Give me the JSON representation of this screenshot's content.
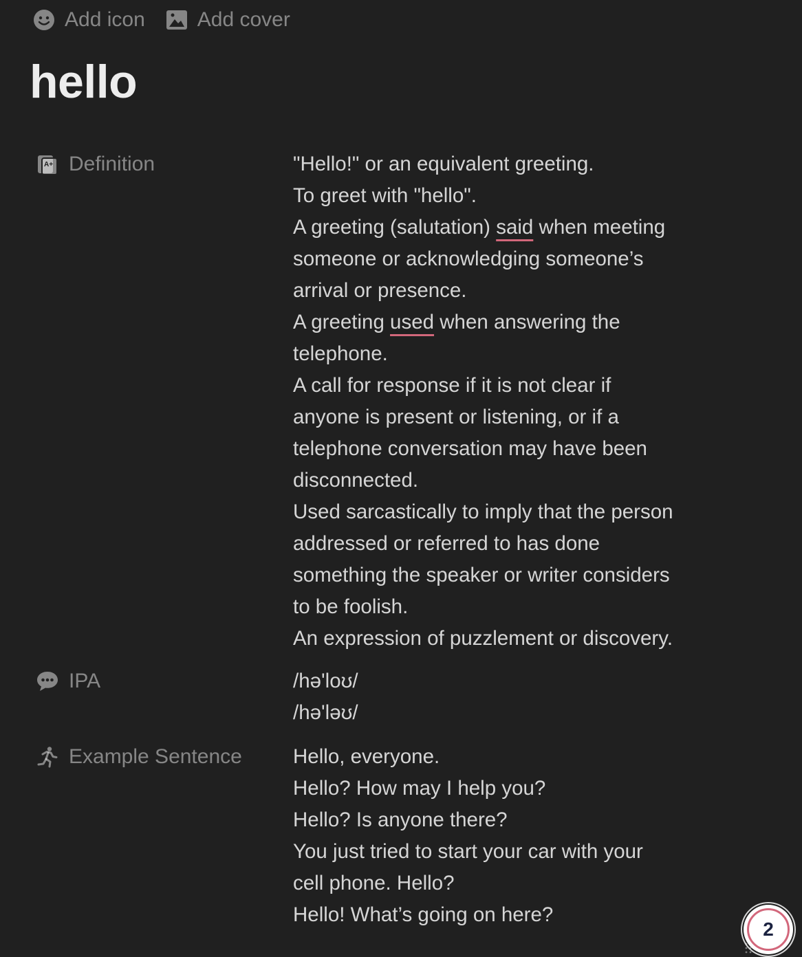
{
  "top_actions": {
    "add_icon_label": "Add icon",
    "add_cover_label": "Add cover"
  },
  "page": {
    "title": "hello"
  },
  "properties": {
    "definition": {
      "label": "Definition",
      "icon": "book-icon"
    },
    "ipa": {
      "label": "IPA",
      "icon": "speech-bubble-icon",
      "lines": [
        "/hə'loʊ/",
        "/hə'ləʊ/"
      ]
    },
    "example": {
      "label": "Example Sentence",
      "icon": "running-person-icon",
      "lines": [
        "Hello, everyone.",
        "Hello? How may I help you?",
        "Hello? Is anyone there?",
        "You just tried to start your car with your",
        "cell phone. Hello?",
        "Hello! What’s going on here?"
      ]
    }
  },
  "definition_text": {
    "l1": "\"Hello!\" or an equivalent greeting.",
    "l2": "To greet with \"hello\".",
    "l3a": "A greeting (salutation) ",
    "l3b": "said",
    "l3c": " when meeting",
    "l4": "someone or acknowledging someone’s",
    "l5": "arrival or presence.",
    "l6a": "A greeting ",
    "l6b": "used",
    "l6c": " when answering the",
    "l7": "telephone.",
    "l8": "A call for response if it is not clear if",
    "l9": "anyone is present or listening, or if a",
    "l10": "telephone conversation may have been",
    "l11": "disconnected.",
    "l12": "Used sarcastically to imply that the person",
    "l13": "addressed or referred to has done",
    "l14": "something the speaker or writer considers",
    "l15": "to be foolish.",
    "l16": "An expression of puzzlement or discovery."
  },
  "help_badge": {
    "count": "2"
  },
  "colors": {
    "background": "#202020",
    "spellcheck_underline": "#d2677b",
    "muted_text": "rgba(255,255,255,0.46)"
  }
}
